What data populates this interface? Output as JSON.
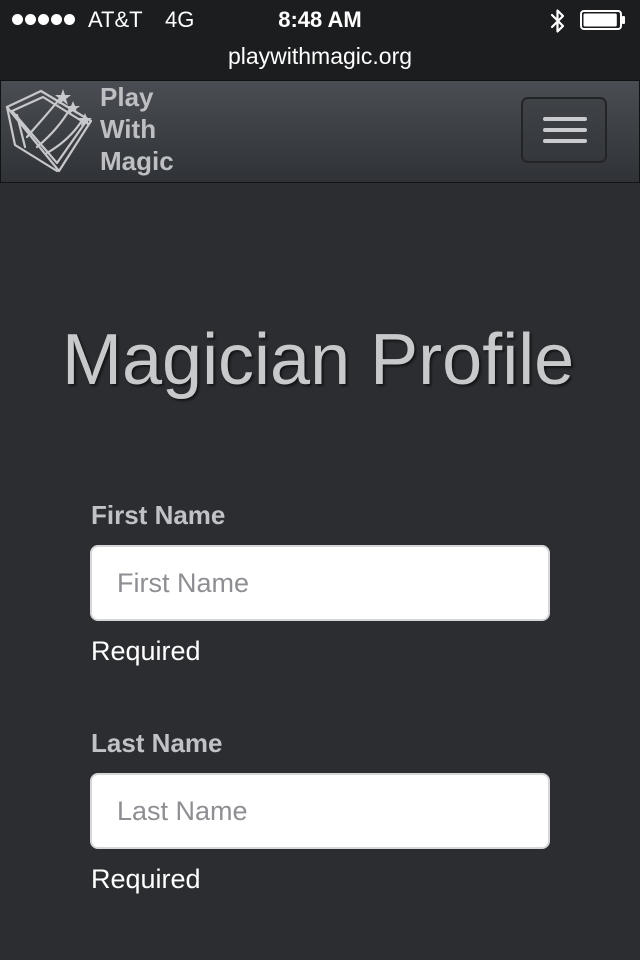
{
  "status_bar": {
    "carrier": "AT&T",
    "network": "4G",
    "time": "8:48 AM",
    "url": "playwithmagic.org",
    "signal_strength_dots": 5,
    "battery_level_percent": 95
  },
  "navbar": {
    "brand_lines": [
      "Play",
      "With",
      "Magic"
    ],
    "logo_icon": "magic-book-icon",
    "menu_icon": "hamburger-icon"
  },
  "main": {
    "title": "Magician Profile",
    "fields": [
      {
        "label": "First Name",
        "placeholder": "First Name",
        "value": "",
        "help": "Required"
      },
      {
        "label": "Last Name",
        "placeholder": "Last Name",
        "value": "",
        "help": "Required"
      }
    ]
  },
  "colors": {
    "page_background": "#2b2d31",
    "status_bar_background": "#1c1d1f",
    "brand_text": "#bdbfc2",
    "title_text": "#c8c9cb"
  }
}
